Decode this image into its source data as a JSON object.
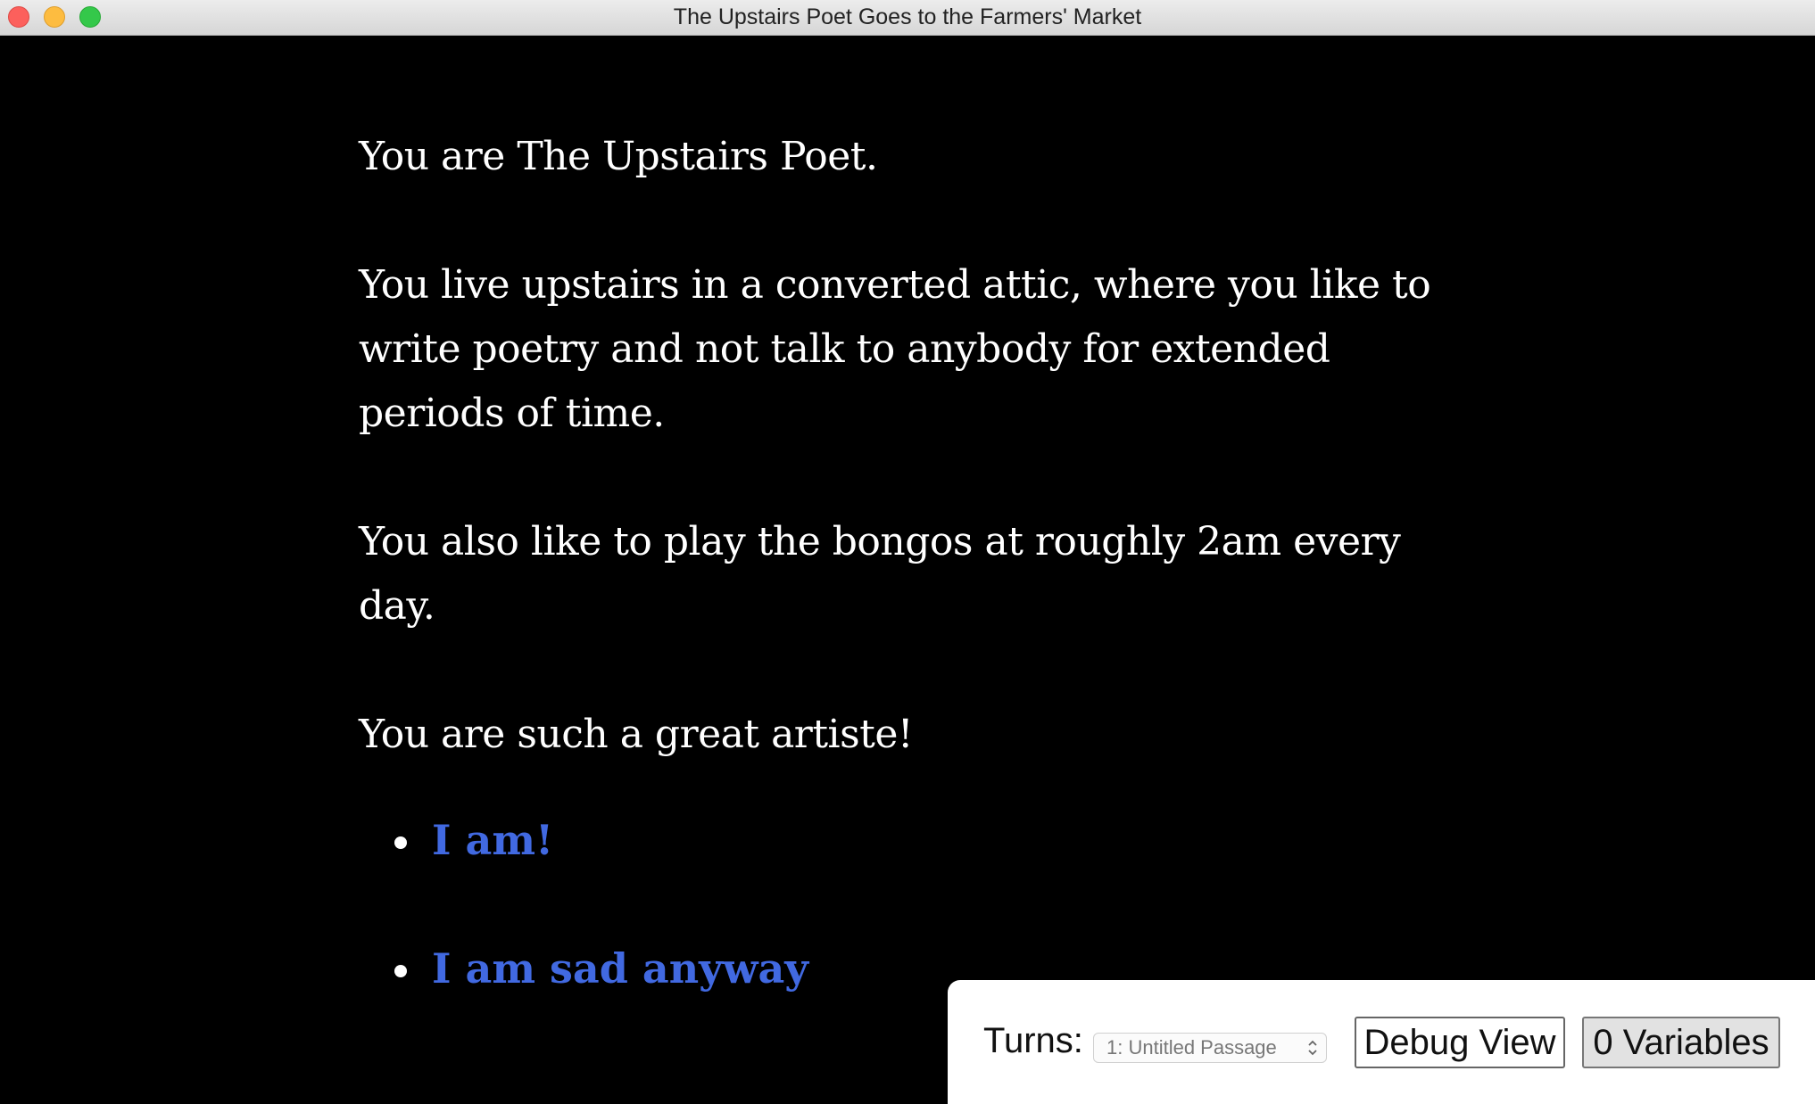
{
  "window": {
    "title": "The Upstairs Poet Goes to the Farmers' Market"
  },
  "story": {
    "paragraphs": [
      "You are The Upstairs Poet.",
      "You live upstairs in a converted attic, where you like to write poetry and not talk to anybody for extended periods of time.",
      "You also like to play the bongos at roughly 2am every day.",
      "You are such a great artiste!"
    ]
  },
  "choices": [
    {
      "label": "I am!"
    },
    {
      "label": "I am sad anyway"
    }
  ],
  "debug": {
    "turns_label": "Turns:",
    "turns_selected": "1: Untitled Passage",
    "debug_view_label": "Debug View",
    "variables_label": "0 Variables"
  },
  "colors": {
    "background": "#000000",
    "text": "#ffffff",
    "link": "#4169e1"
  }
}
